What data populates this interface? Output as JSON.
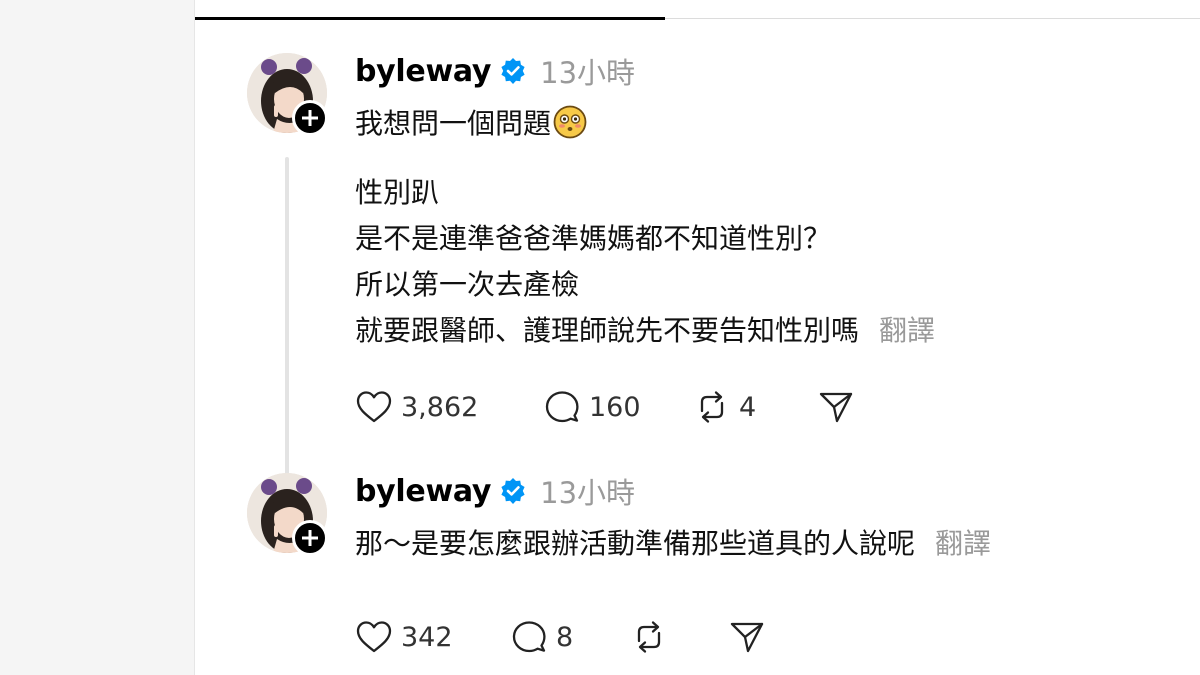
{
  "posts": [
    {
      "username": "byleway",
      "time": "13小時",
      "first_line": "我想問一個問題",
      "lines": [
        "性別趴",
        "是不是連準爸爸準媽媽都不知道性別？",
        "所以第一次去產檢",
        "就要跟醫師、護理師說先不要告知性別嗎"
      ],
      "translate_label": "翻譯",
      "likes": "3,862",
      "comments": "160",
      "reposts": "4",
      "emoji_icon": "flushed-face-icon"
    },
    {
      "username": "byleway",
      "time": "13小時",
      "first_line": "那～是要怎麼跟辦活動準備那些道具的人說呢",
      "translate_label": "翻譯",
      "likes": "342",
      "comments": "8"
    }
  ],
  "colors": {
    "verified": "#0095f6",
    "muted": "#9a9a9a",
    "text": "#111111"
  }
}
